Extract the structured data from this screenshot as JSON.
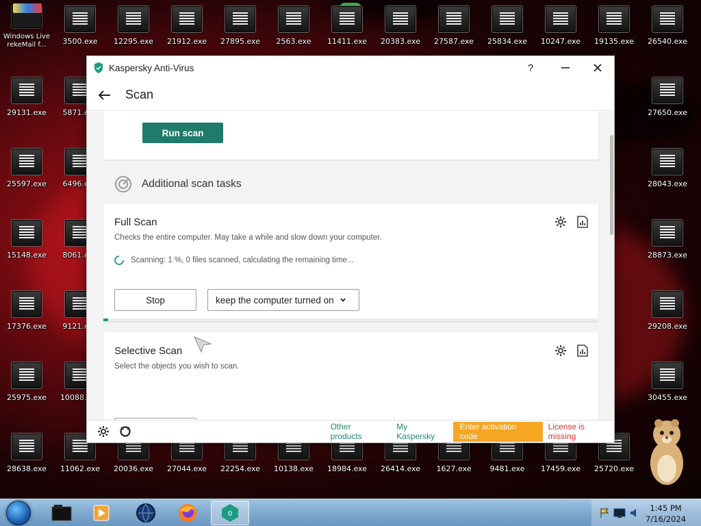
{
  "desktop": {
    "icons": [
      {
        "label": "Windows Live\nrekeMail f...",
        "type": "windows-live"
      },
      {
        "label": "3500.exe"
      },
      {
        "label": "12295.exe"
      },
      {
        "label": "21912.exe"
      },
      {
        "label": "27895.exe"
      },
      {
        "label": "2563.exe"
      },
      {
        "label": "11411.exe"
      },
      {
        "label": "20383.exe"
      },
      {
        "label": "27587.exe"
      },
      {
        "label": "25834.exe"
      },
      {
        "label": "10247.exe"
      },
      {
        "label": "19135.exe"
      },
      {
        "label": "26540.exe"
      },
      {
        "label": "29131.exe"
      },
      {
        "label": "5871.exe"
      },
      {
        "label": "27650.exe"
      },
      {
        "label": "25597.exe"
      },
      {
        "label": "6496.exe"
      },
      {
        "label": "28043.exe"
      },
      {
        "label": "15148.exe"
      },
      {
        "label": "8061.exe"
      },
      {
        "label": "28873.exe"
      },
      {
        "label": "17376.exe"
      },
      {
        "label": "9121.exe"
      },
      {
        "label": "29208.exe"
      },
      {
        "label": "25975.exe"
      },
      {
        "label": "10088.exe"
      },
      {
        "label": "30455.exe"
      },
      {
        "label": "28638.exe"
      },
      {
        "label": "11062.exe"
      },
      {
        "label": "20036.exe"
      },
      {
        "label": "27044.exe"
      },
      {
        "label": "22254.exe"
      },
      {
        "label": "10138.exe"
      },
      {
        "label": "18984.exe"
      },
      {
        "label": "26414.exe"
      },
      {
        "label": "1627.exe"
      },
      {
        "label": "9481.exe"
      },
      {
        "label": "17459.exe"
      },
      {
        "label": "25720.exe"
      }
    ]
  },
  "window": {
    "title": "Kaspersky Anti-Virus",
    "help": "?",
    "minimize": "—",
    "close": "✕",
    "page_title": "Scan"
  },
  "run_scan": {
    "label": "Run scan"
  },
  "additional": {
    "title": "Additional scan tasks"
  },
  "full_scan": {
    "title": "Full Scan",
    "description": "Checks the entire computer. May take a while and slow down your computer.",
    "status": "Scanning: 1 %, 0 files scanned, calculating the remaining time...",
    "stop_label": "Stop",
    "power_option": "keep the computer turned on",
    "progress": 0.01
  },
  "selective_scan": {
    "title": "Selective Scan",
    "description": "Select the objects you wish to scan."
  },
  "footer": {
    "other_products": "Other products",
    "my_kaspersky": "My Kaspersky",
    "activation": "Enter activation code",
    "license": "License is missing"
  },
  "taskbar": {
    "time": "1:45 PM",
    "date": "7/16/2024"
  },
  "colors": {
    "accent": "#207b6a",
    "link": "#1f8a72",
    "activation": "#f5a623",
    "license": "#d8302a"
  }
}
